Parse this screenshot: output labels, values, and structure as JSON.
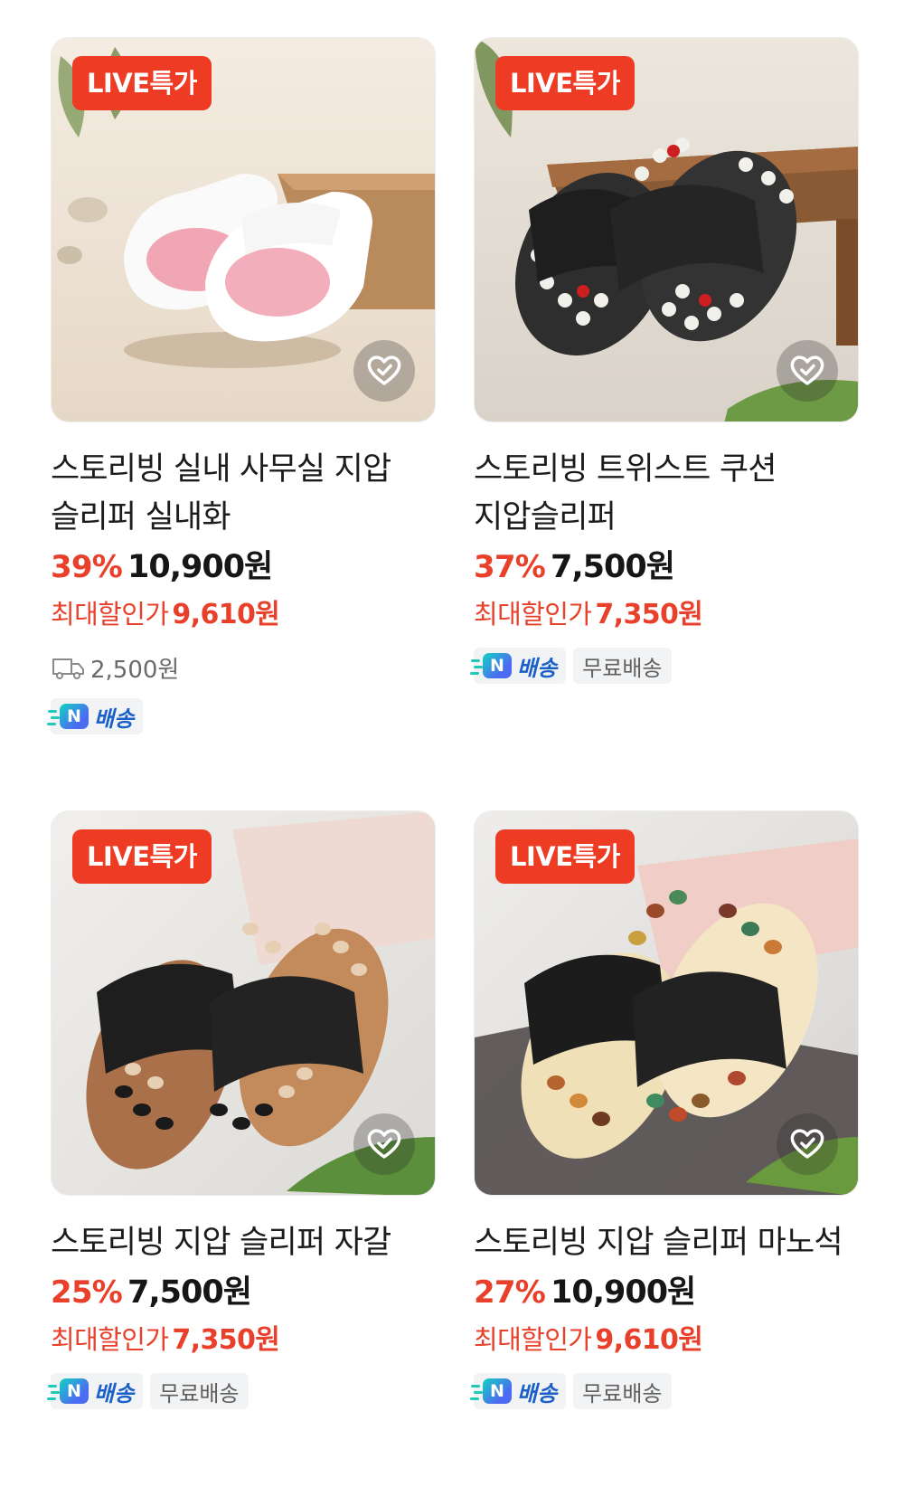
{
  "products": [
    {
      "badge": "LIVE특가",
      "title": "스토리빙 실내 사무실 지압 슬리퍼 실내화",
      "discount": "39%",
      "price": "10,900원",
      "max_discount_label": "최대할인가",
      "max_discount_price": "9,610원",
      "shipping_fee": "2,500원",
      "n_delivery": "배송",
      "wish_icon": "heart-check-icon"
    },
    {
      "badge": "LIVE특가",
      "title": "스토리빙 트위스트 쿠션 지압슬리퍼",
      "discount": "37%",
      "price": "7,500원",
      "max_discount_label": "최대할인가",
      "max_discount_price": "7,350원",
      "n_delivery": "배송",
      "free_shipping": "무료배송",
      "wish_icon": "heart-check-icon"
    },
    {
      "badge": "LIVE특가",
      "title": "스토리빙 지압 슬리퍼 자갈",
      "discount": "25%",
      "price": "7,500원",
      "max_discount_label": "최대할인가",
      "max_discount_price": "7,350원",
      "n_delivery": "배송",
      "free_shipping": "무료배송",
      "wish_icon": "heart-check-icon"
    },
    {
      "badge": "LIVE특가",
      "title": "스토리빙 지압 슬리퍼 마노석",
      "discount": "27%",
      "price": "10,900원",
      "max_discount_label": "최대할인가",
      "max_discount_price": "9,610원",
      "n_delivery": "배송",
      "free_shipping": "무료배송",
      "wish_icon": "heart-check-icon"
    }
  ],
  "n_logo_letter": "N",
  "colors": {
    "accent_red": "#ee3b24",
    "discount_red": "#e8402a",
    "n_blue": "#1b5fc9"
  }
}
